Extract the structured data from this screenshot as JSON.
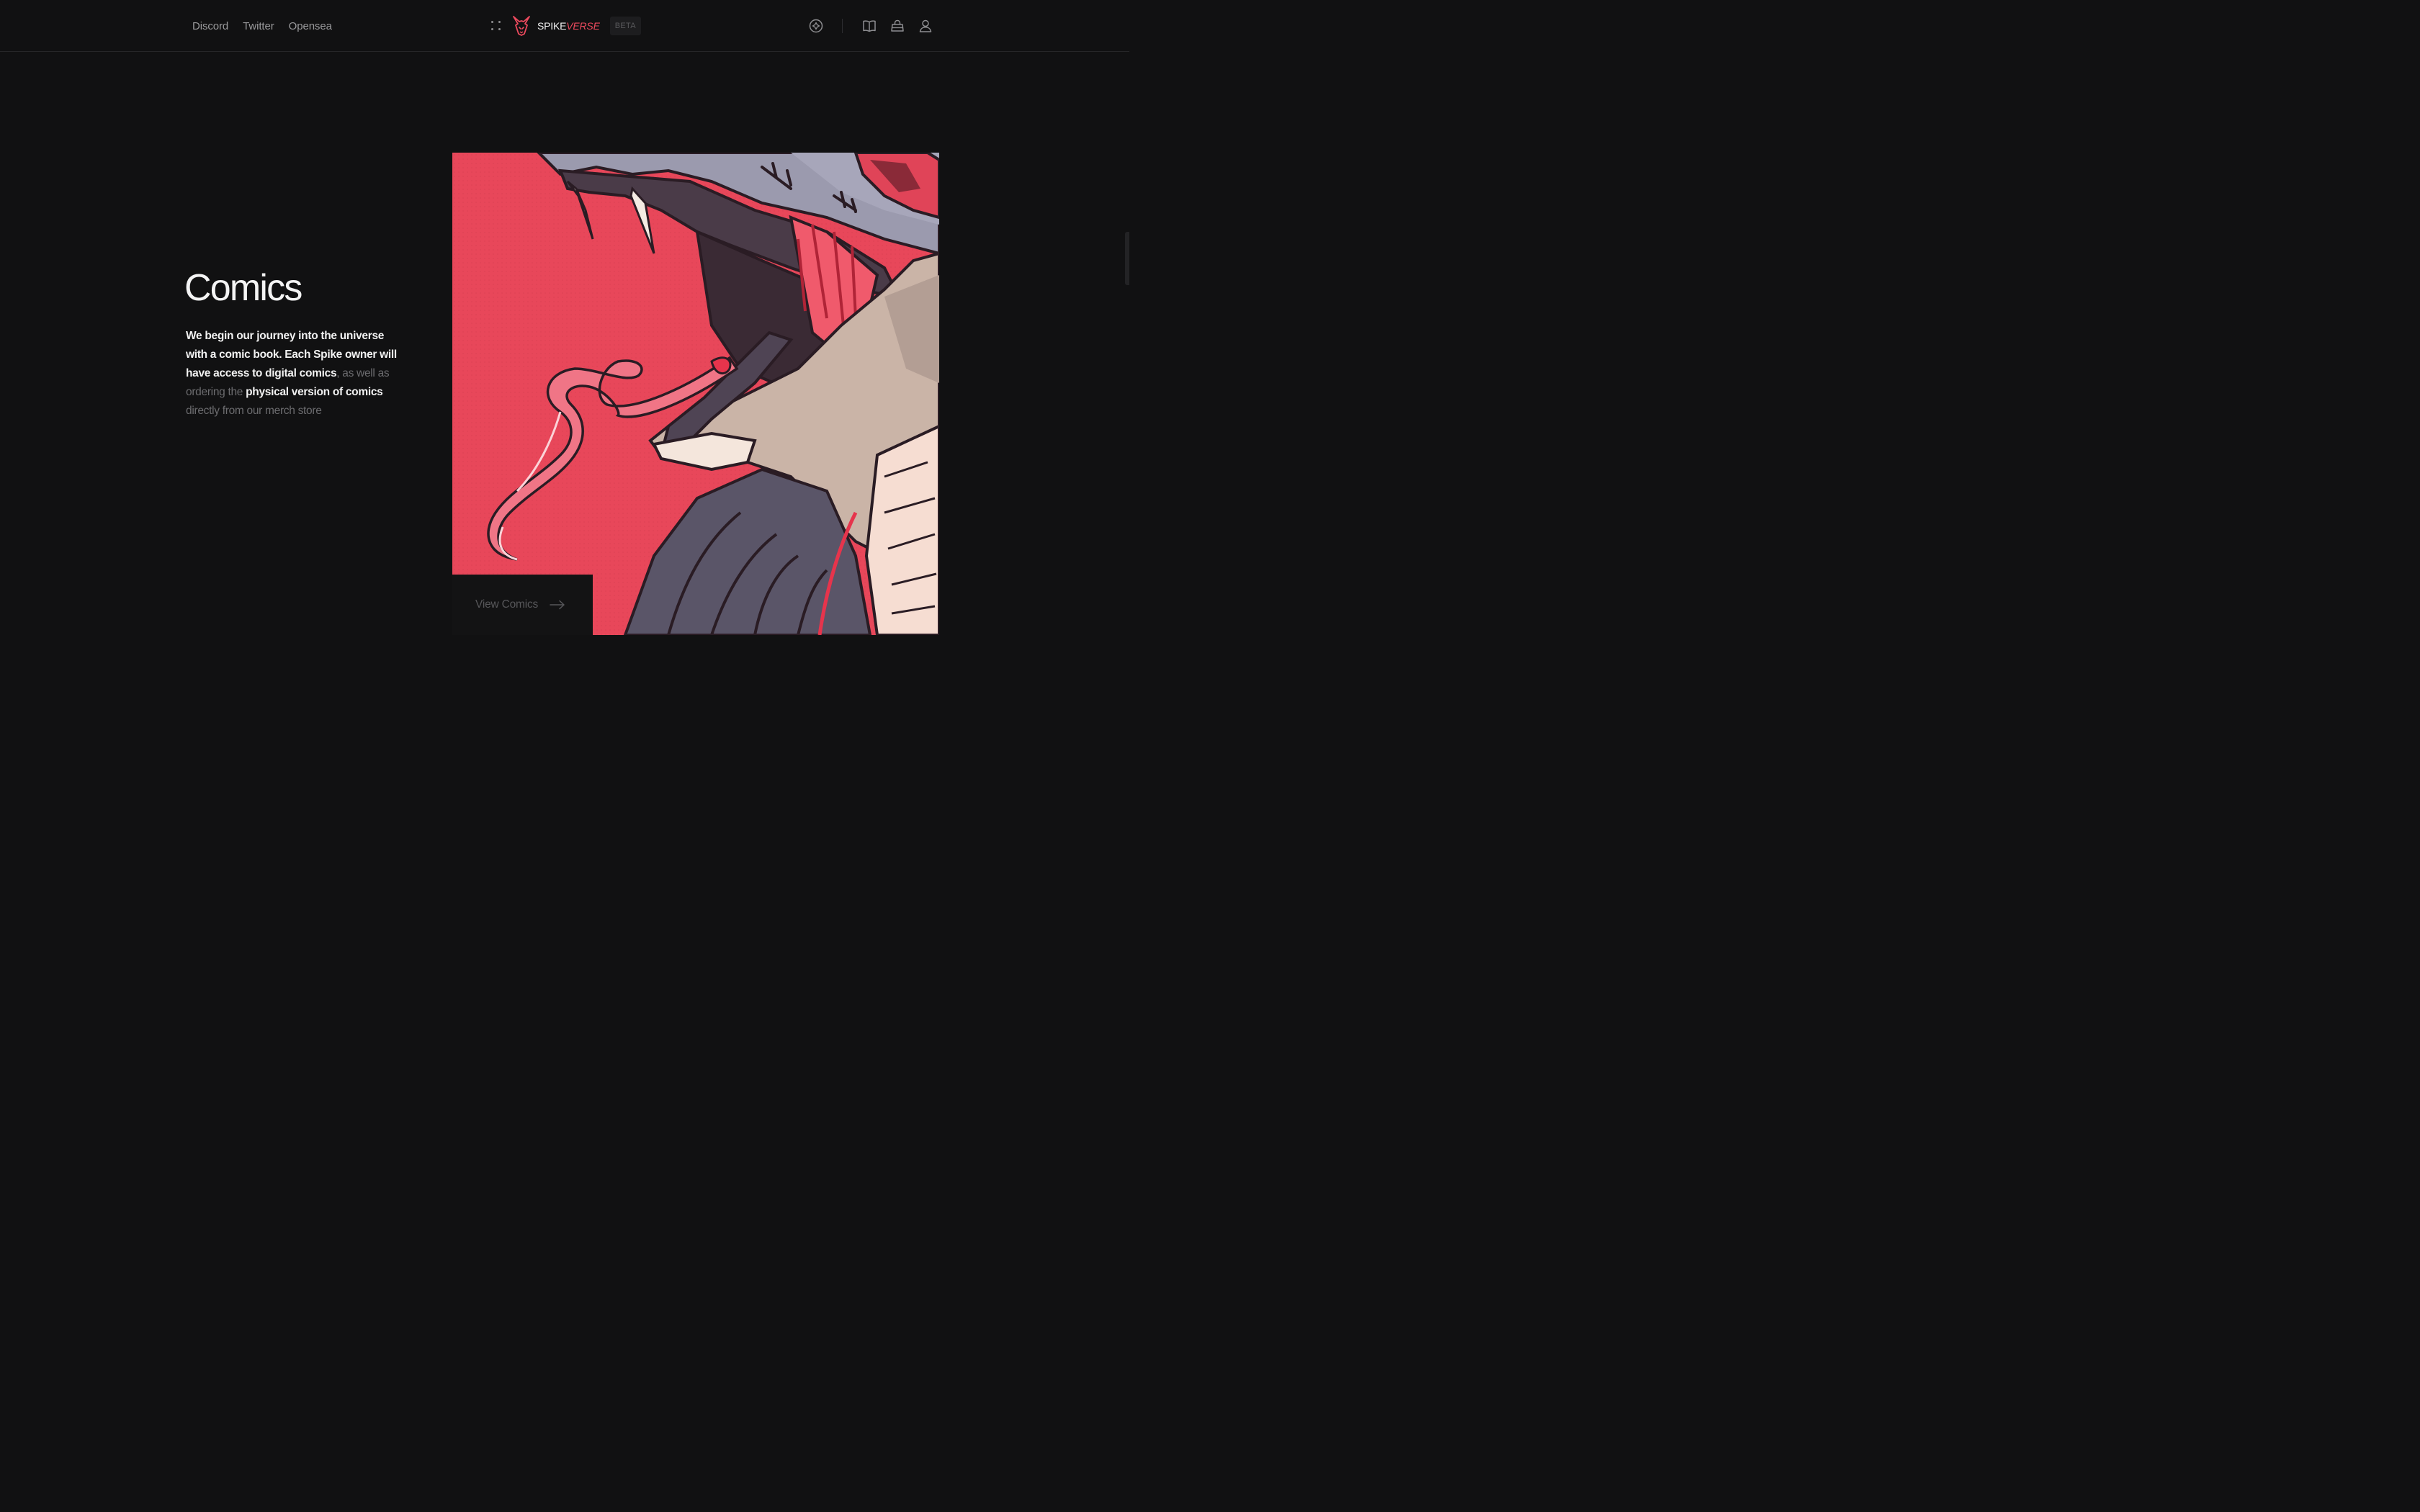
{
  "header": {
    "links": [
      {
        "label": "Discord"
      },
      {
        "label": "Twitter"
      },
      {
        "label": "Opensea"
      }
    ],
    "brand": {
      "part1": "SPIKE",
      "part2": "VERSE",
      "badge": "BETA"
    },
    "icons": [
      "compass-icon",
      "book-icon",
      "shopping-bag-icon",
      "user-icon"
    ]
  },
  "comics": {
    "title": "Comics",
    "text": {
      "seg1": "We begin our journey into the universe with a comic book. Each Spike owner will have access to digital comics",
      "seg2": ", as well as ordering the ",
      "seg3": "physical version of comics",
      "seg4": " directly from our merch store"
    },
    "cta_label": "View Comics"
  },
  "colors": {
    "background": "#111112",
    "accent": "#ee4a5e",
    "art_red": "#e8475a",
    "muted_text": "#6c6c6f"
  }
}
